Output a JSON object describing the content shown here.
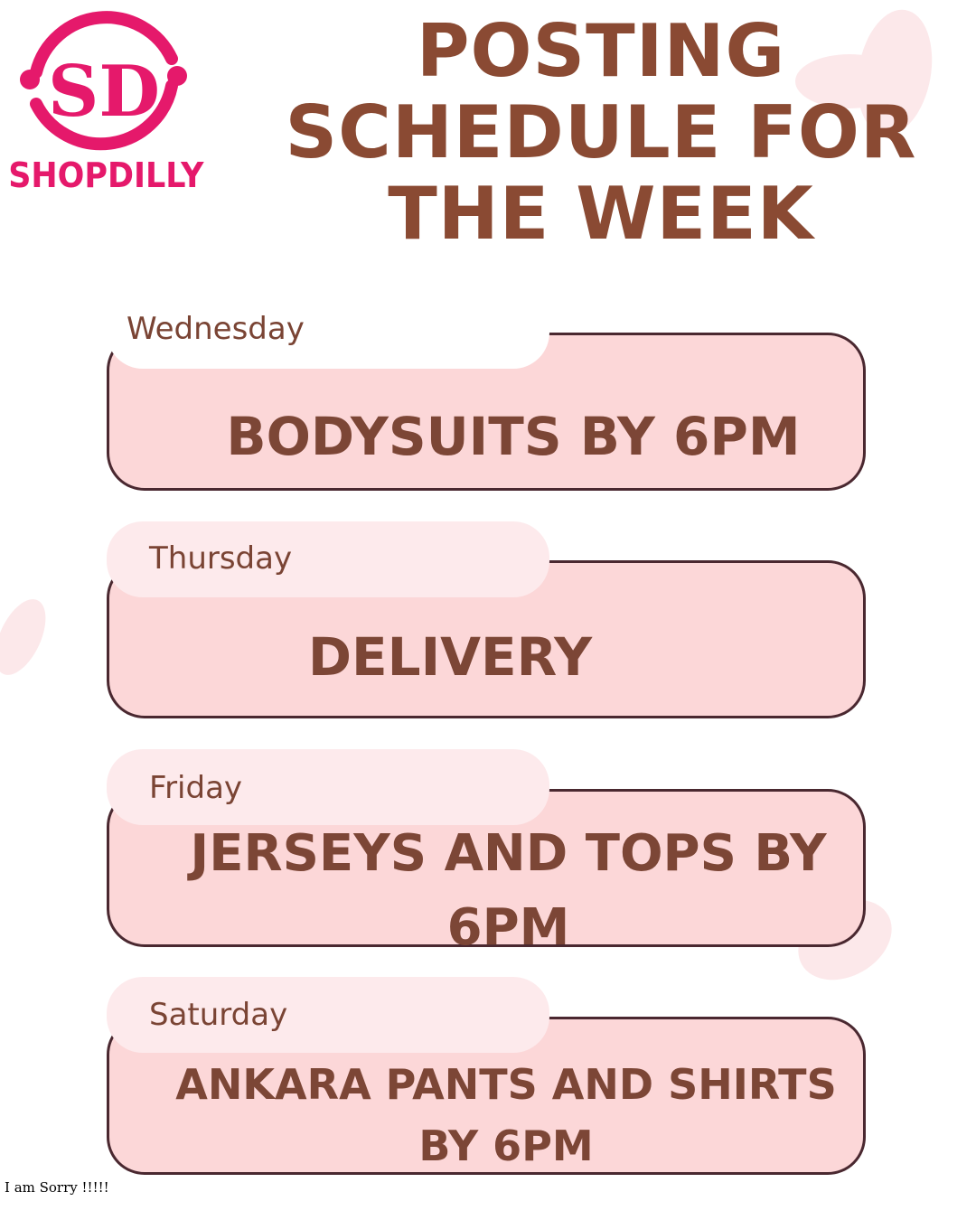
{
  "brand": {
    "name": "SHOPDILLY",
    "monogram": "SD",
    "color": "#e5196b"
  },
  "title": {
    "lines": [
      "POSTING",
      "SCHEDULE FOR",
      "THE WEEK"
    ],
    "color": "#8a4a33"
  },
  "schedule": [
    {
      "day": "Wednesday",
      "task": "BODYSUITS BY 6PM"
    },
    {
      "day": "Thursday",
      "task": "DELIVERY"
    },
    {
      "day": "Friday",
      "task": "JERSEYS AND TOPS BY 6PM"
    },
    {
      "day": "Saturday",
      "task": "ANKARA PANTS AND SHIRTS BY 6PM"
    }
  ],
  "footer_note": "I am Sorry !!!!!"
}
